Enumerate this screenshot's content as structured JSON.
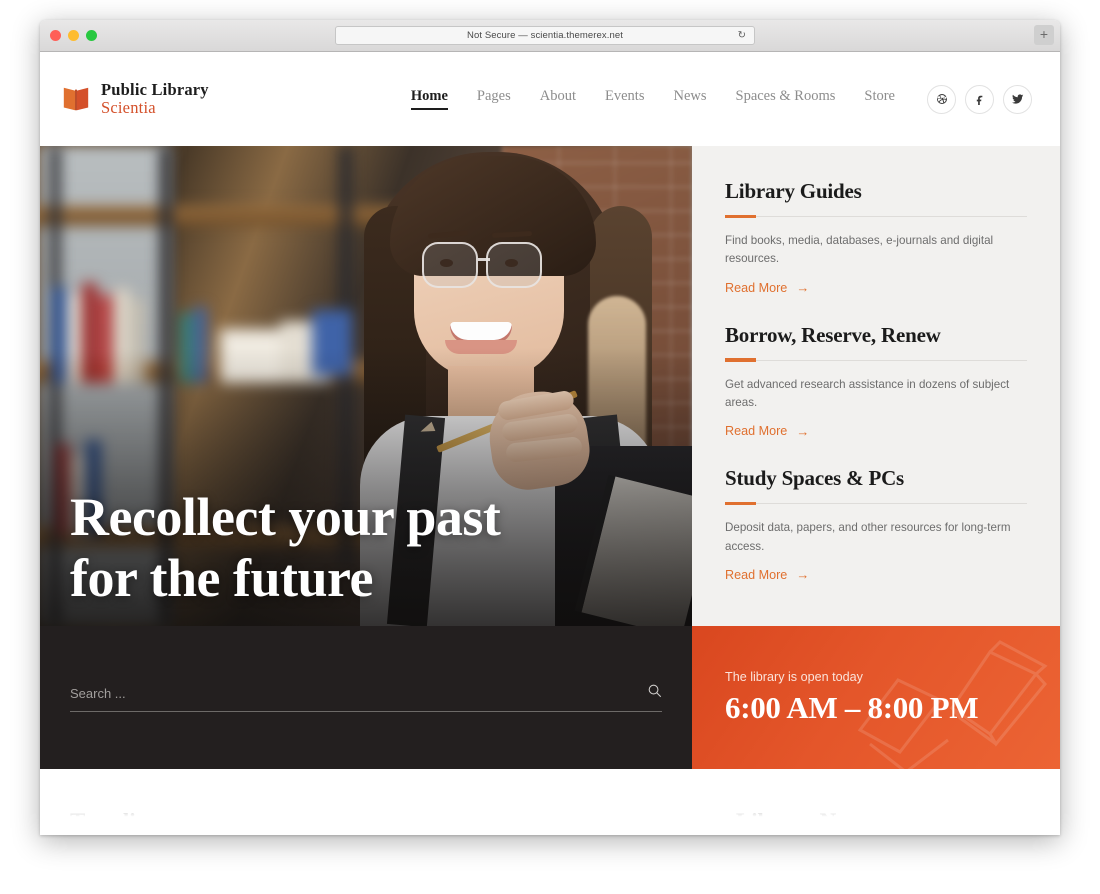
{
  "browser": {
    "url_text": "Not Secure — scientia.themerex.net",
    "reload_icon": "reload-icon",
    "new_tab_label": "+"
  },
  "header": {
    "logo": {
      "icon": "open-book-icon",
      "line1": "Public Library",
      "line2": "Scientia"
    },
    "nav": [
      {
        "label": "Home",
        "active": true
      },
      {
        "label": "Pages",
        "active": false
      },
      {
        "label": "About",
        "active": false
      },
      {
        "label": "Events",
        "active": false
      },
      {
        "label": "News",
        "active": false
      },
      {
        "label": "Spaces & Rooms",
        "active": false
      },
      {
        "label": "Store",
        "active": false
      }
    ],
    "social": [
      {
        "name": "dribbble-icon"
      },
      {
        "name": "facebook-icon"
      },
      {
        "name": "twitter-icon"
      }
    ]
  },
  "hero": {
    "title_line1": "Recollect your past",
    "title_line2": "for the future",
    "image_description": "smiling woman with glasses holding a pencil in a library"
  },
  "features": [
    {
      "title": "Library Guides",
      "desc": "Find books, media, databases, e-journals and digital resources.",
      "link": "Read More",
      "arrow": "→"
    },
    {
      "title": "Borrow, Reserve, Renew",
      "desc": "Get advanced research assistance in dozens of subject areas.",
      "link": "Read More",
      "arrow": "→"
    },
    {
      "title": "Study Spaces & PCs",
      "desc": "Deposit data, papers, and other resources for long-term access.",
      "link": "Read More",
      "arrow": "→"
    }
  ],
  "search": {
    "placeholder": "Search ...",
    "value": "",
    "icon": "search-icon"
  },
  "hours": {
    "label": "The library is open today",
    "value": "6:00 AM – 8:00 PM",
    "watermark": "books-watermark-icon"
  },
  "next_section": {
    "left_heading": "Trending",
    "right_heading": "Library News"
  },
  "colors": {
    "accent_orange": "#e0702f",
    "hours_orange": "#e4562a",
    "logo_orange": "#d4502a",
    "dark_bar": "#231f1f",
    "card_bg": "#f2f1ef",
    "text_dark": "#1b1b1b",
    "text_muted": "#6d6d6d"
  }
}
